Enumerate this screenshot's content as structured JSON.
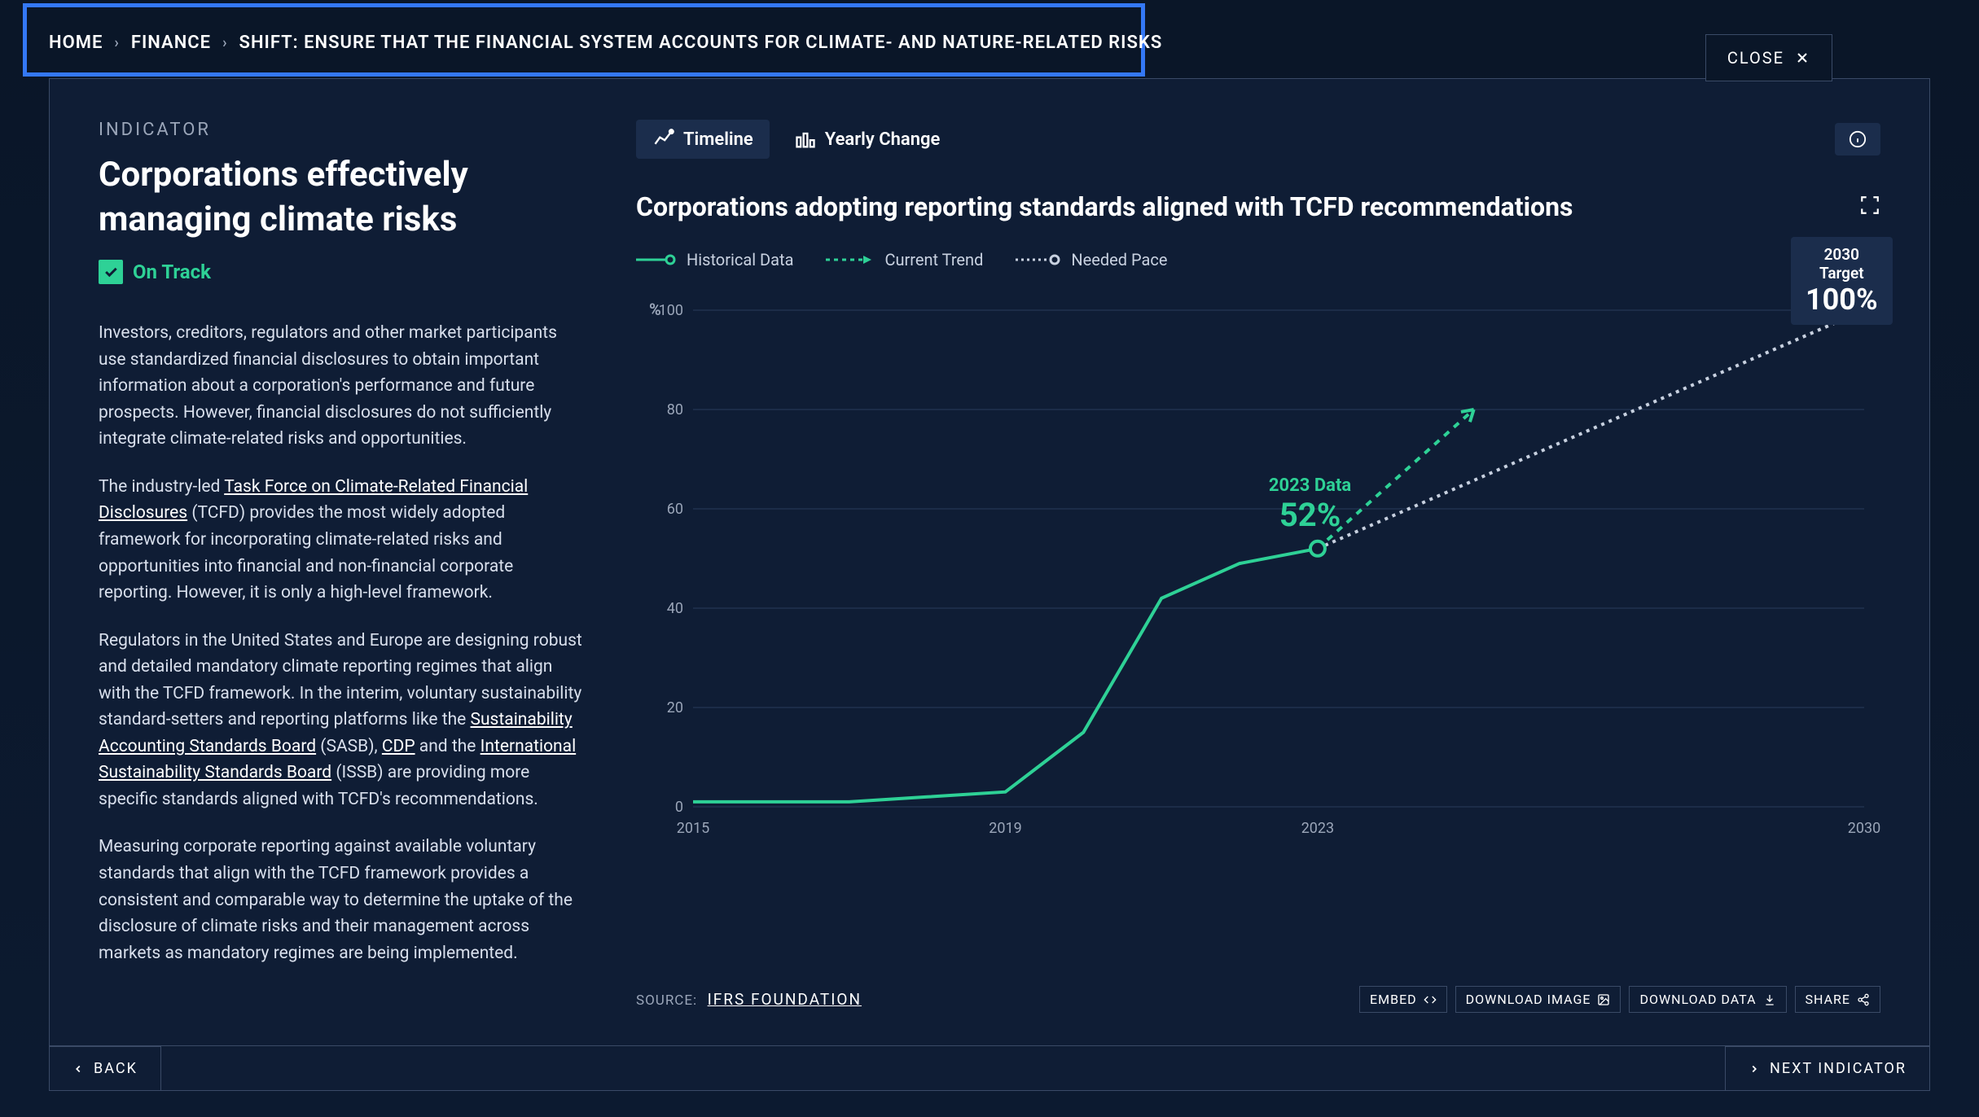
{
  "breadcrumb": {
    "home": "HOME",
    "finance": "FINANCE",
    "shift": "SHIFT: ENSURE THAT THE FINANCIAL SYSTEM ACCOUNTS FOR CLIMATE- AND NATURE-RELATED RISKS"
  },
  "close_label": "CLOSE",
  "indicator": {
    "label": "INDICATOR",
    "title": "Corporations effectively managing climate risks",
    "status": "On Track"
  },
  "body": {
    "p1": "Investors, creditors, regulators and other market participants use standardized financial disclosures to obtain important information about a corporation's performance and future prospects. However, financial disclosures do not sufficiently integrate climate-related risks and opportunities.",
    "p2a": "The industry-led ",
    "p2_link1": "Task Force on Climate-Related Financial Disclosures",
    "p2b": " (TCFD) provides the most widely adopted framework for incorporating climate-related risks and opportunities into financial and non-financial corporate reporting. However, it is only a high-level framework.",
    "p3a": "Regulators in the United States and Europe are designing robust and detailed mandatory climate reporting regimes that align with the TCFD framework. In the interim, voluntary sustainability standard-setters and reporting platforms like the ",
    "p3_link1": "Sustainability Accounting Standards Board",
    "p3b": " (SASB), ",
    "p3_link2": "CDP",
    "p3c": " and the ",
    "p3_link3": "International Sustainability Standards Board",
    "p3d": " (ISSB) are providing more specific standards aligned with TCFD's recommendations.",
    "p4": "Measuring corporate reporting against available voluntary standards that align with the TCFD framework provides a consistent and comparable way to determine the uptake of the disclosure of climate risks and their management across markets as mandatory regimes are being implemented."
  },
  "tabs": {
    "timeline": "Timeline",
    "yearly": "Yearly Change"
  },
  "chart": {
    "title": "Corporations adopting reporting standards aligned with TCFD recommendations",
    "legend": {
      "historical": "Historical Data",
      "trend": "Current Trend",
      "needed": "Needed Pace"
    },
    "y_unit": "%",
    "target": {
      "label": "2030 Target",
      "value": "100%"
    },
    "current": {
      "label": "2023 Data",
      "value": "52%"
    },
    "source_label": "SOURCE:",
    "source": "IFRS FOUNDATION"
  },
  "actions": {
    "embed": "EMBED",
    "download_image": "DOWNLOAD IMAGE",
    "download_data": "DOWNLOAD DATA",
    "share": "SHARE"
  },
  "nav": {
    "back": "BACK",
    "next": "NEXT INDICATOR"
  },
  "chart_data": {
    "type": "line",
    "title": "Corporations adopting reporting standards aligned with TCFD recommendations",
    "xlabel": "",
    "ylabel": "%",
    "x_ticks": [
      2015,
      2019,
      2023,
      2030
    ],
    "y_ticks": [
      0,
      20,
      40,
      60,
      80,
      100
    ],
    "xlim": [
      2015,
      2030
    ],
    "ylim": [
      0,
      100
    ],
    "series": [
      {
        "name": "Historical Data",
        "style": "solid",
        "color": "#2ed196",
        "x": [
          2015,
          2016,
          2017,
          2018,
          2019,
          2020,
          2021,
          2022,
          2023
        ],
        "y": [
          1,
          1,
          1,
          2,
          3,
          15,
          42,
          49,
          52
        ]
      },
      {
        "name": "Current Trend",
        "style": "dashed-arrow",
        "color": "#2ed196",
        "x": [
          2023,
          2025
        ],
        "y": [
          52,
          80
        ]
      },
      {
        "name": "Needed Pace",
        "style": "dotted",
        "color": "#c8d1e0",
        "x": [
          2023,
          2030
        ],
        "y": [
          52,
          100
        ]
      }
    ],
    "annotations": [
      {
        "label": "2023 Data",
        "value": "52%",
        "x": 2023,
        "y": 52
      },
      {
        "label": "2030 Target",
        "value": "100%",
        "x": 2030,
        "y": 100
      }
    ]
  }
}
